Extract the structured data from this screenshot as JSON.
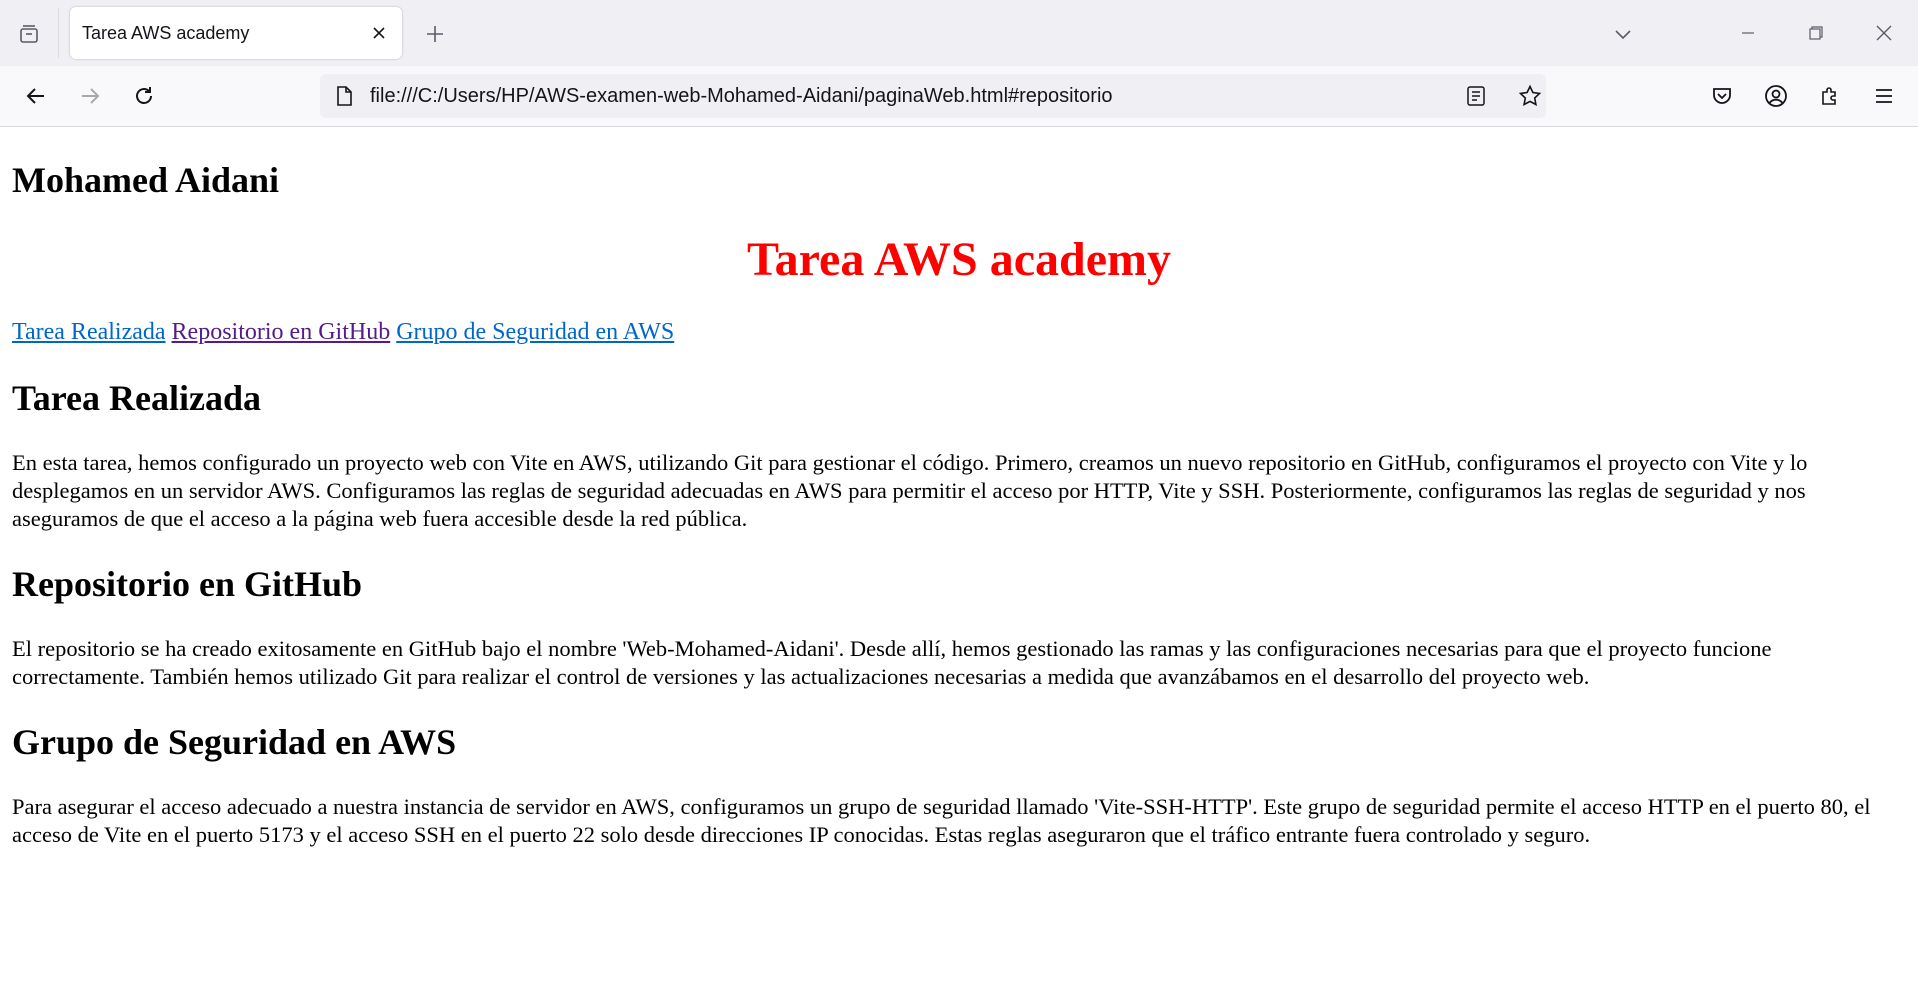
{
  "browser": {
    "tab_title": "Tarea AWS academy",
    "url": "file:///C:/Users/HP/AWS-examen-web-Mohamed-Aidani/paginaWeb.html#repositorio"
  },
  "page": {
    "author": "Mohamed Aidani",
    "title": "Tarea AWS academy",
    "nav": [
      {
        "label": "Tarea Realizada"
      },
      {
        "label": "Repositorio en GitHub"
      },
      {
        "label": "Grupo de Seguridad en AWS"
      }
    ],
    "sections": [
      {
        "heading": "Tarea Realizada",
        "text": "En esta tarea, hemos configurado un proyecto web con Vite en AWS, utilizando Git para gestionar el código. Primero, creamos un nuevo repositorio en GitHub, configuramos el proyecto con Vite y lo desplegamos en un servidor AWS. Configuramos las reglas de seguridad adecuadas en AWS para permitir el acceso por HTTP, Vite y SSH. Posteriormente, configuramos las reglas de seguridad y nos aseguramos de que el acceso a la página web fuera accesible desde la red pública."
      },
      {
        "heading": "Repositorio en GitHub",
        "text": "El repositorio se ha creado exitosamente en GitHub bajo el nombre 'Web-Mohamed-Aidani'. Desde allí, hemos gestionado las ramas y las configuraciones necesarias para que el proyecto funcione correctamente. También hemos utilizado Git para realizar el control de versiones y las actualizaciones necesarias a medida que avanzábamos en el desarrollo del proyecto web."
      },
      {
        "heading": "Grupo de Seguridad en AWS",
        "text": "Para asegurar el acceso adecuado a nuestra instancia de servidor en AWS, configuramos un grupo de seguridad llamado 'Vite-SSH-HTTP'. Este grupo de seguridad permite el acceso HTTP en el puerto 80, el acceso de Vite en el puerto 5173 y el acceso SSH en el puerto 22 solo desde direcciones IP conocidas. Estas reglas aseguraron que el tráfico entrante fuera controlado y seguro."
      }
    ]
  },
  "icons": {
    "tab_overview": "tab-overview-icon",
    "close_tab": "close-icon",
    "new_tab": "plus-icon",
    "list_tabs": "chevron-down-icon",
    "minimize": "minimize-icon",
    "restore": "restore-icon",
    "close_window": "close-icon",
    "back": "arrow-left-icon",
    "forward": "arrow-right-icon",
    "reload": "reload-icon",
    "page": "page-icon",
    "reader": "reader-view-icon",
    "bookmark": "star-icon",
    "pocket": "pocket-icon",
    "account": "account-icon",
    "extensions": "puzzle-icon",
    "menu": "hamburger-menu-icon"
  },
  "colors": {
    "title": "#ff0000",
    "link": "#0066cc",
    "link_visited": "#551a8b"
  }
}
